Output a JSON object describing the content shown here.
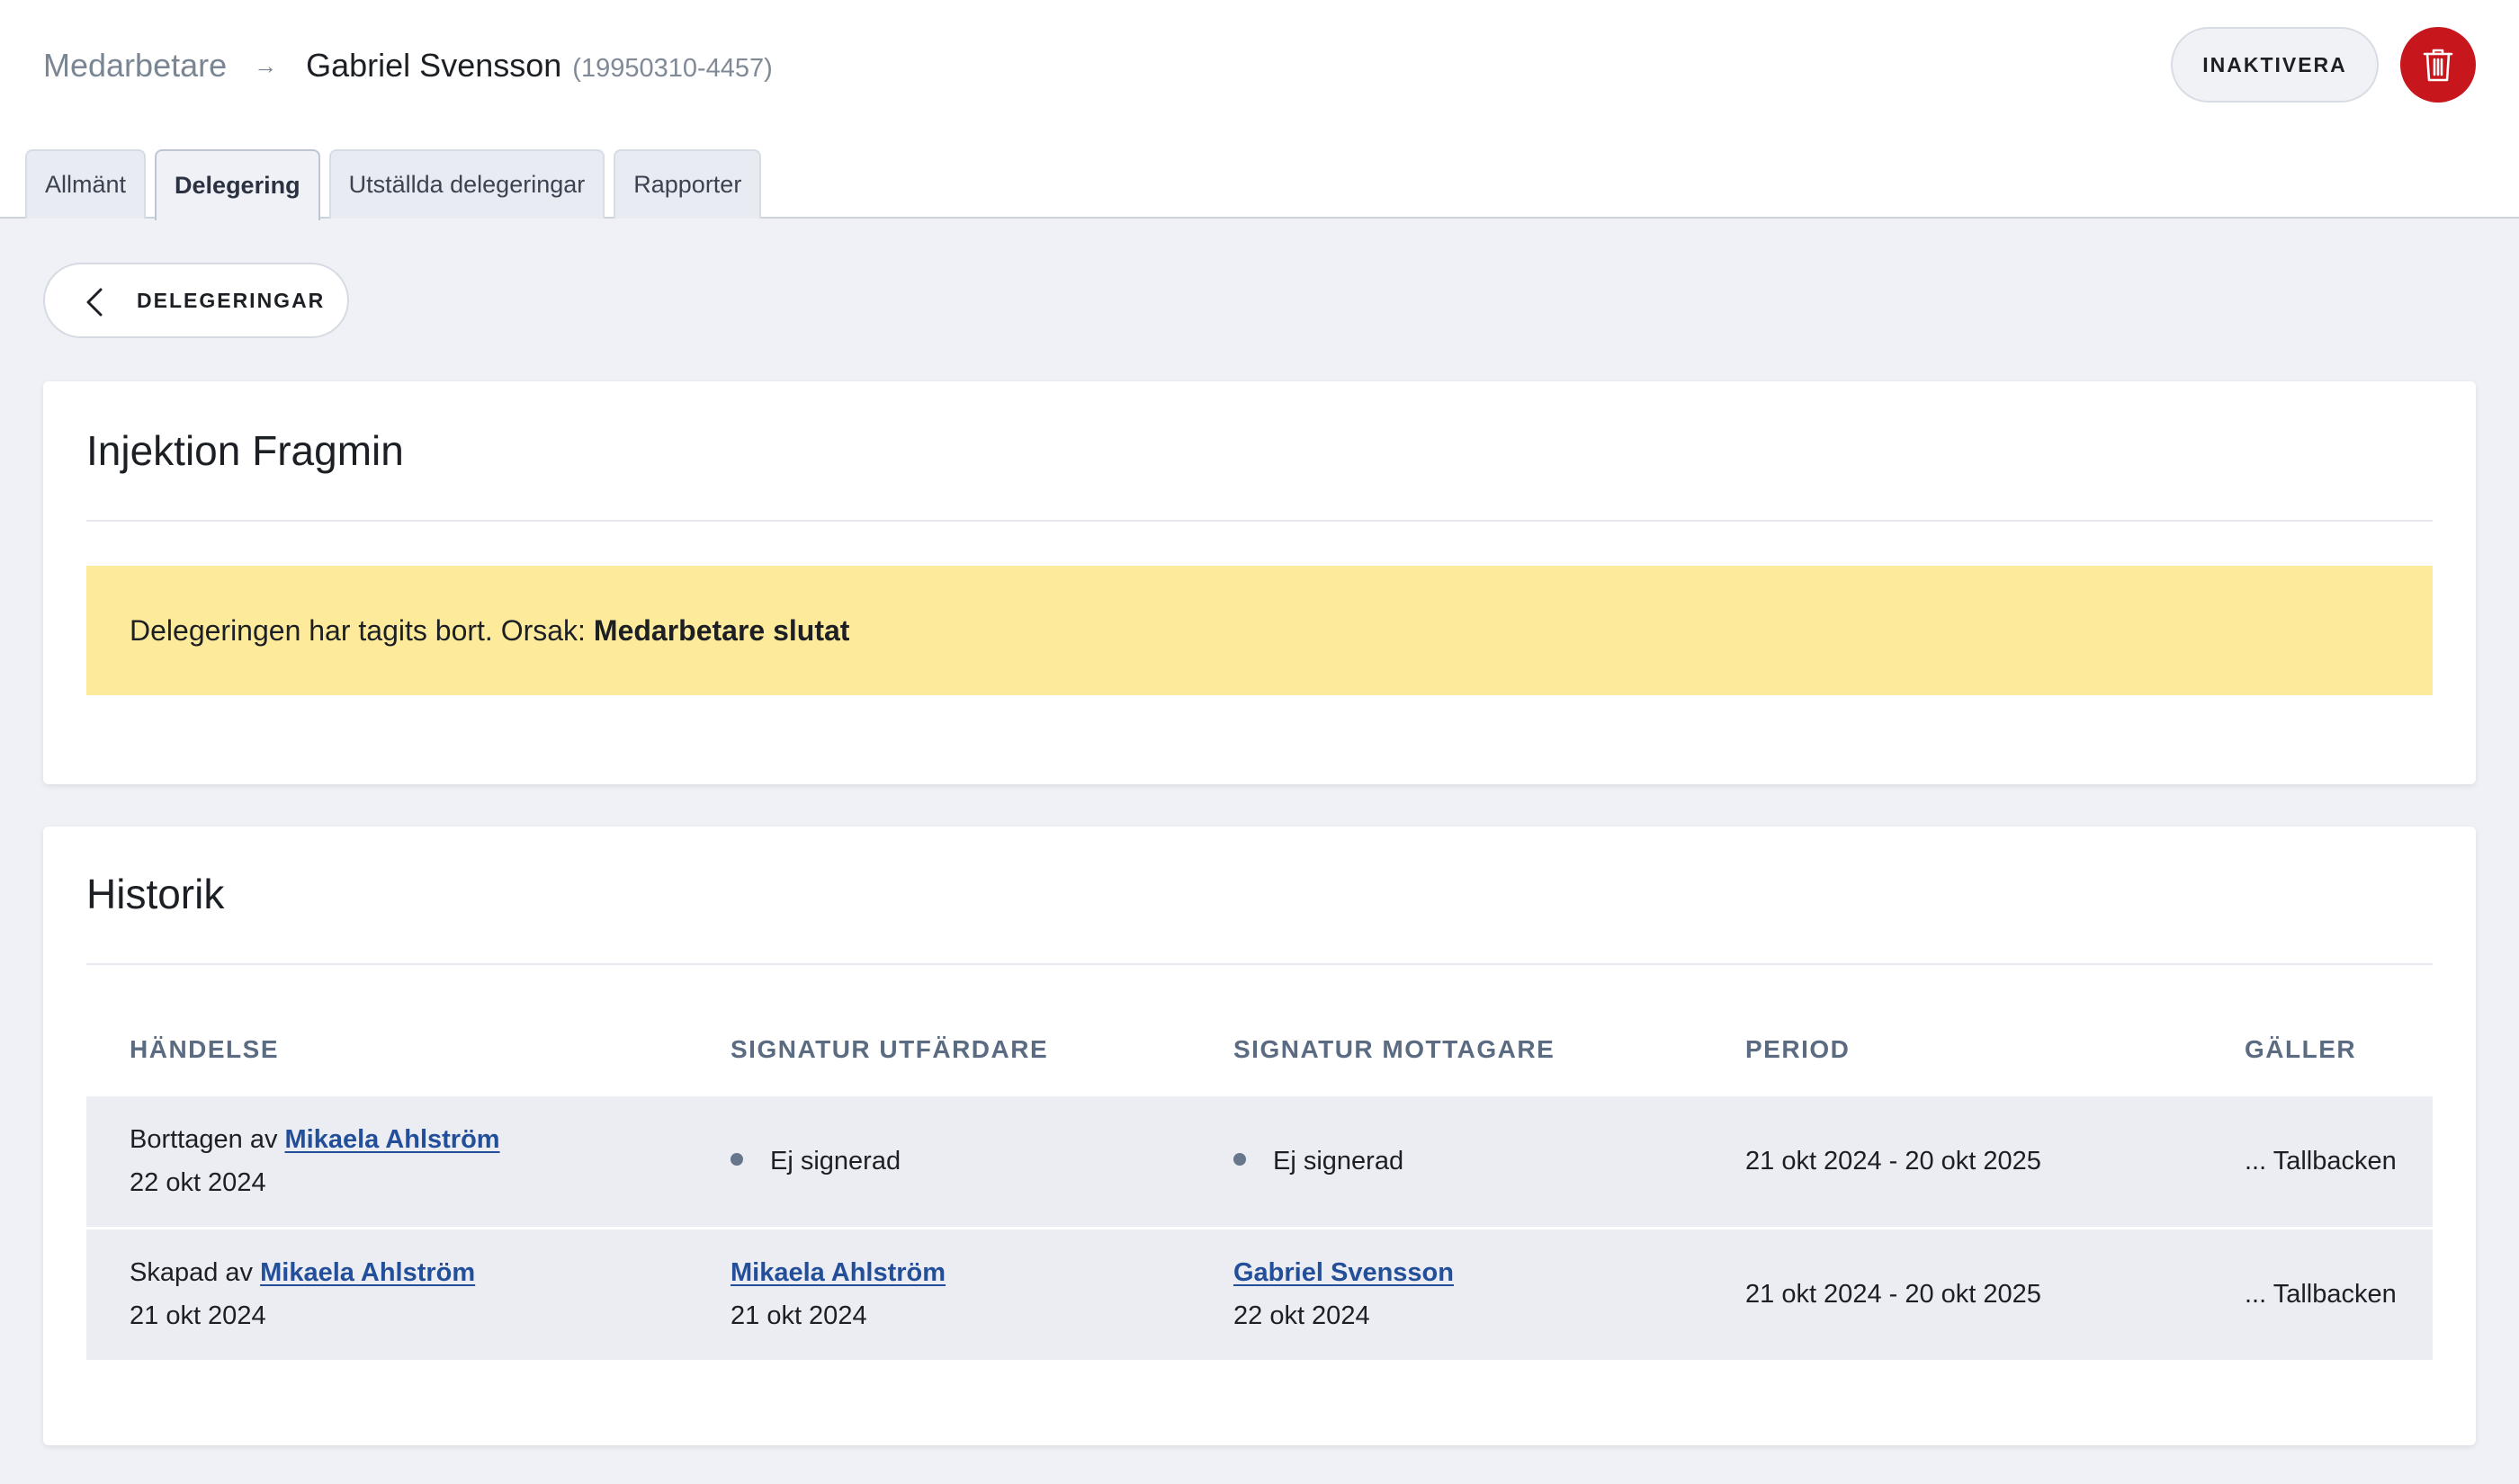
{
  "breadcrumb": {
    "parent": "Medarbetare",
    "current": "Gabriel Svensson",
    "person_id": "(19950310-4457)"
  },
  "header_actions": {
    "inactivate_label": "INAKTIVERA",
    "delete_icon": "trash-icon",
    "delete_color": "#c8161d"
  },
  "tabs": [
    {
      "label": "Allmänt",
      "active": false
    },
    {
      "label": "Delegering",
      "active": true
    },
    {
      "label": "Utställda delegeringar",
      "active": false
    },
    {
      "label": "Rapporter",
      "active": false
    }
  ],
  "back_button": {
    "label": "DELEGERINGAR",
    "icon": "chevron-left-icon"
  },
  "delegation": {
    "title": "Injektion Fragmin",
    "alert_text": "Delegeringen har tagits bort. Orsak:",
    "alert_reason": "Medarbetare slutat",
    "alert_color": "#fdeb9b"
  },
  "history": {
    "title": "Historik",
    "columns": [
      "HÄNDELSE",
      "SIGNATUR UTFÄRDARE",
      "SIGNATUR MOTTAGARE",
      "PERIOD",
      "GÄLLER"
    ],
    "rows": [
      {
        "event_prefix": "Borttagen av",
        "event_person": "Mikaela Ahlström",
        "event_date": "22 okt 2024",
        "issuer_status": "Ej signerad",
        "recipient_status": "Ej signerad",
        "period": "21 okt 2024 - 20 okt 2025",
        "applies": "... Tallbacken"
      },
      {
        "event_prefix": "Skapad av",
        "event_person": "Mikaela Ahlström",
        "event_date": "21 okt 2024",
        "issuer_name": "Mikaela Ahlström",
        "issuer_date": "21 okt 2024",
        "recipient_name": "Gabriel Svensson",
        "recipient_date": "22 okt 2024",
        "period": "21 okt 2024 - 20 okt 2025",
        "applies": "... Tallbacken"
      }
    ]
  }
}
